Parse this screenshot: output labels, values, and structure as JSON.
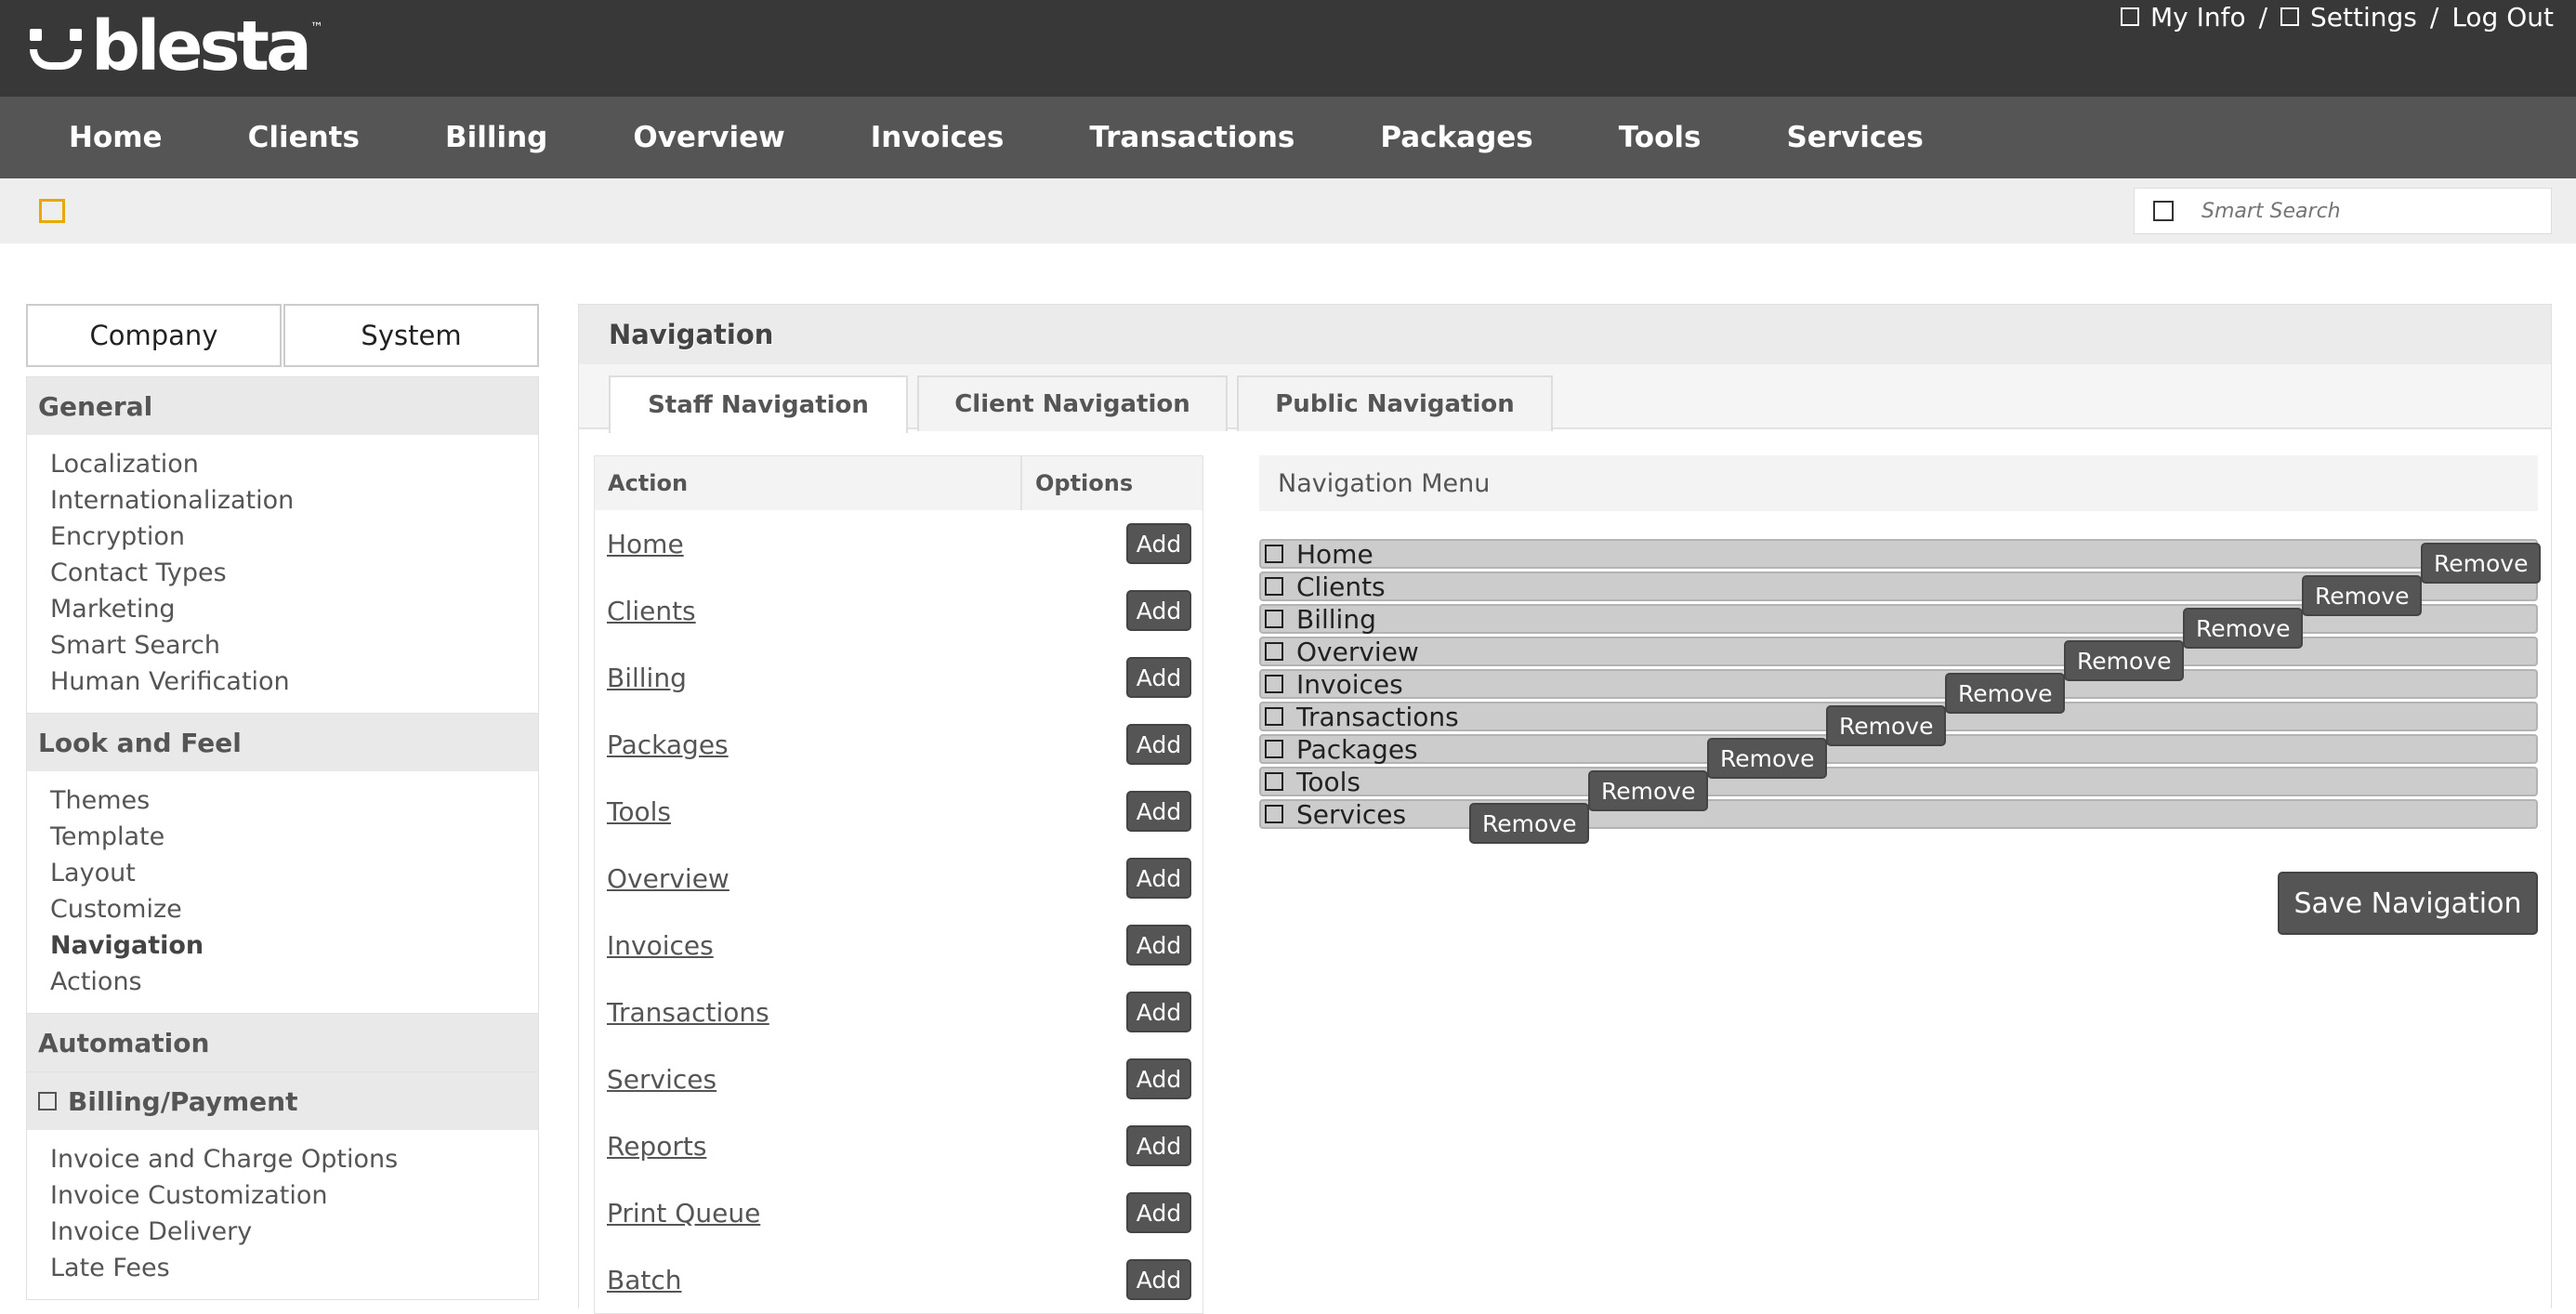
{
  "brand": {
    "name": "blesta",
    "tm": "™"
  },
  "toplinks": {
    "my_info": "My Info",
    "settings": "Settings",
    "logout": "Log Out",
    "sep": "/"
  },
  "mainnav": [
    "Home",
    "Clients",
    "Billing",
    "Overview",
    "Invoices",
    "Transactions",
    "Packages",
    "Tools",
    "Services"
  ],
  "search": {
    "placeholder": "Smart Search"
  },
  "sidebar": {
    "switch": [
      "Company",
      "System"
    ],
    "sections": [
      {
        "title": "General",
        "items": [
          "Localization",
          "Internationalization",
          "Encryption",
          "Contact Types",
          "Marketing",
          "Smart Search",
          "Human Verification"
        ]
      },
      {
        "title": "Look and Feel",
        "items": [
          "Themes",
          "Template",
          "Layout",
          "Customize",
          "Navigation",
          "Actions"
        ],
        "active": "Navigation"
      },
      {
        "title": "Automation",
        "items": []
      },
      {
        "title": "Billing/Payment",
        "items": [
          "Invoice and Charge Options",
          "Invoice Customization",
          "Invoice Delivery",
          "Late Fees"
        ]
      }
    ]
  },
  "content": {
    "title": "Navigation",
    "tabs": [
      "Staff Navigation",
      "Client Navigation",
      "Public Navigation"
    ],
    "actions_table": {
      "headers": [
        "Action",
        "Options"
      ],
      "add_label": "Add",
      "rows": [
        "Home",
        "Clients",
        "Billing",
        "Packages",
        "Tools",
        "Overview",
        "Invoices",
        "Transactions",
        "Services",
        "Reports",
        "Print Queue",
        "Batch"
      ]
    },
    "menu": {
      "heading": "Navigation Menu",
      "remove_label": "Remove",
      "items": [
        "Home",
        "Clients",
        "Billing",
        "Overview",
        "Invoices",
        "Transactions",
        "Packages",
        "Tools",
        "Services"
      ],
      "save_label": "Save Navigation"
    }
  },
  "colors": {
    "topbar": "#383838",
    "mainnav": "#555555",
    "button": "#555555",
    "accent_star": "#e8a800"
  }
}
